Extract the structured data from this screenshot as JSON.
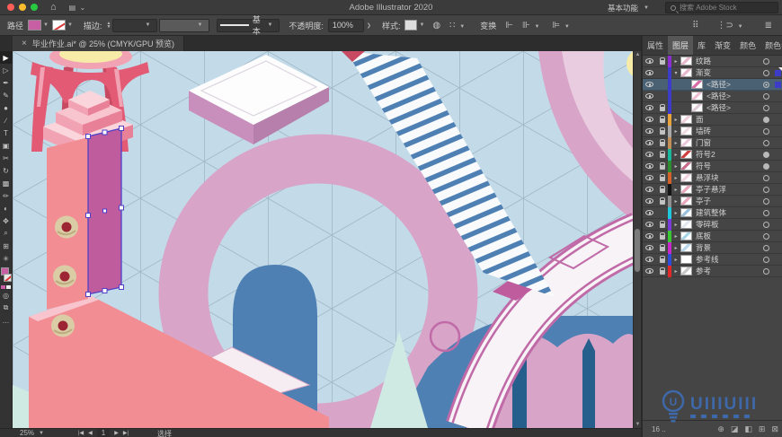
{
  "app": {
    "title": "Adobe Illustrator 2020",
    "workspace_switcher": "基本功能",
    "search_placeholder": "搜索 Adobe Stock",
    "traffic_lights": [
      "#ff5f57",
      "#febc2e",
      "#28c840"
    ]
  },
  "control_bar": {
    "selection_type": "路径",
    "fill_color": "#C85FA5",
    "stroke_label": "描边:",
    "brush_name": "基本",
    "opacity_label": "不透明度:",
    "opacity_value": "100%",
    "style_label": "样式:",
    "transform_label": "变换",
    "icons": [
      {
        "name": "recolor-artwork-icon",
        "glyph": "◍"
      },
      {
        "name": "align-pixel-grid-icon",
        "glyph": "∷"
      },
      {
        "name": "align-objects-icon",
        "glyph": "⊩"
      },
      {
        "name": "distribute-objects-icon",
        "glyph": "⊪"
      }
    ],
    "right_icons": [
      {
        "name": "document-setup-icon",
        "glyph": "⠿"
      },
      {
        "name": "shape-mode-icon",
        "glyph": "⋮⊃"
      },
      {
        "name": "panel-options-icon",
        "glyph": "≣"
      }
    ]
  },
  "document": {
    "tab_title": "毕业作业.ai* @ 25% (CMYK/GPU 预览)",
    "close_glyph": "×"
  },
  "toolbar": {
    "tools": [
      {
        "name": "selection-tool",
        "glyph": "▶",
        "active": true
      },
      {
        "name": "direct-selection-tool",
        "glyph": "▷",
        "active": false
      },
      {
        "name": "pen-tool",
        "glyph": "✒",
        "active": false
      },
      {
        "name": "curvature-tool",
        "glyph": "✎",
        "active": false
      },
      {
        "name": "ellipse-tool",
        "glyph": "●",
        "active": false
      },
      {
        "name": "line-segment-tool",
        "glyph": "∕",
        "active": false
      },
      {
        "name": "type-tool",
        "glyph": "T",
        "active": false
      },
      {
        "name": "rectangle-tool",
        "glyph": "▣",
        "active": false
      },
      {
        "name": "scissors-tool",
        "glyph": "✂",
        "active": false
      },
      {
        "name": "rotate-tool",
        "glyph": "↻",
        "active": false
      },
      {
        "name": "gradient-tool",
        "glyph": "▩",
        "active": false
      },
      {
        "name": "paintbrush-tool",
        "glyph": "✏",
        "active": false
      },
      {
        "name": "shape-builder-tool",
        "glyph": "◐",
        "active": false
      },
      {
        "name": "hand-tool",
        "glyph": "✥",
        "active": false
      },
      {
        "name": "zoom-tool",
        "glyph": "⌕",
        "active": false
      },
      {
        "name": "artboard-tool",
        "glyph": "⊞",
        "active": false
      },
      {
        "name": "symbol-sprayer-tool",
        "glyph": "✳",
        "active": false
      }
    ],
    "more_glyph": "…"
  },
  "canvas": {
    "selection_outline_color": "#5040C8",
    "watermark_text": "UIIIUIII",
    "watermark_color": "#3d6fba"
  },
  "status_bar": {
    "zoom_value": "25%",
    "first_glyph": "|◀",
    "prev_glyph": "◀",
    "artboard_number": "1",
    "next_glyph": "▶",
    "last_glyph": "▶|",
    "tool_status": "选择"
  },
  "layers_panel": {
    "tabs": [
      {
        "label": "属性",
        "active": false
      },
      {
        "label": "图层",
        "active": true
      },
      {
        "label": "库",
        "active": false
      },
      {
        "label": "渐变",
        "active": false
      },
      {
        "label": "颜色",
        "active": false
      },
      {
        "label": "颜色参",
        "active": false
      }
    ],
    "menu_glyph": "≡",
    "rows": [
      {
        "name": "纹路",
        "color": "#8b2fd0",
        "locked": true,
        "arrow": "▸",
        "thumb": "#e8b8cc",
        "target": "o",
        "sub": false,
        "selected": false,
        "sel_square": false,
        "corner": false
      },
      {
        "name": "渐变",
        "color": "#3c3cc8",
        "locked": false,
        "arrow": "▾",
        "thumb": "#e8b8cc",
        "target": "o",
        "sub": false,
        "selected": false,
        "sel_square": true,
        "corner": true
      },
      {
        "name": "<路径>",
        "color": "#3c3cc8",
        "locked": false,
        "arrow": "",
        "thumb": "#d86aa8",
        "target": "dot",
        "sub": true,
        "selected": true,
        "sel_square": true,
        "corner": false
      },
      {
        "name": "<路径>",
        "color": "#3c3cc8",
        "locked": false,
        "arrow": "",
        "thumb": "#f0c0d4",
        "target": "o",
        "sub": true,
        "selected": false,
        "sel_square": false,
        "corner": false
      },
      {
        "name": "<路径>",
        "color": "#3c3cc8",
        "locked": true,
        "arrow": "",
        "thumb": "#e0ccd8",
        "target": "o",
        "sub": true,
        "selected": false,
        "sel_square": false,
        "corner": false
      },
      {
        "name": "面",
        "color": "#e8a33c",
        "locked": true,
        "arrow": "▸",
        "thumb": "#f0d0dc",
        "target": "fill",
        "sub": false,
        "selected": false,
        "sel_square": false,
        "corner": false
      },
      {
        "name": "墙砖",
        "color": "#a9a9a9",
        "locked": true,
        "arrow": "▸",
        "thumb": "#f0dce4",
        "target": "o",
        "sub": false,
        "selected": false,
        "sel_square": false,
        "corner": false
      },
      {
        "name": "门窗",
        "color": "#c29057",
        "locked": true,
        "arrow": "▸",
        "thumb": "#eccadc",
        "target": "o",
        "sub": false,
        "selected": false,
        "sel_square": false,
        "corner": false
      },
      {
        "name": "符号2",
        "color": "#17b89b",
        "locked": true,
        "arrow": "▸",
        "thumb": "#d04040",
        "target": "fill",
        "sub": false,
        "selected": false,
        "sel_square": false,
        "corner": false
      },
      {
        "name": "符号",
        "color": "#2f8b2f",
        "locked": true,
        "arrow": "▸",
        "thumb": "#c86a8a",
        "target": "fill",
        "sub": false,
        "selected": false,
        "sel_square": false,
        "corner": false
      },
      {
        "name": "悬浮块",
        "color": "#d2622a",
        "locked": true,
        "arrow": "▸",
        "thumb": "#f0d4e0",
        "target": "o",
        "sub": false,
        "selected": false,
        "sel_square": false,
        "corner": false
      },
      {
        "name": "亭子悬浮",
        "color": "#151515",
        "locked": true,
        "arrow": "▸",
        "thumb": "#eaa8bc",
        "target": "o",
        "sub": false,
        "selected": false,
        "sel_square": false,
        "corner": false
      },
      {
        "name": "亭子",
        "color": "#8f8f8f",
        "locked": true,
        "arrow": "▸",
        "thumb": "#eaa8bc",
        "target": "o",
        "sub": false,
        "selected": false,
        "sel_square": false,
        "corner": false
      },
      {
        "name": "建筑整体",
        "color": "#20c8dc",
        "locked": false,
        "arrow": "▸",
        "thumb": "#9cc0dc",
        "target": "o",
        "sub": false,
        "selected": false,
        "sel_square": false,
        "corner": false
      },
      {
        "name": "零碎板",
        "color": "#7a3cd8",
        "locked": true,
        "arrow": "▸",
        "thumb": "#e4e8f0",
        "target": "o",
        "sub": false,
        "selected": false,
        "sel_square": false,
        "corner": false
      },
      {
        "name": "底板",
        "color": "#38c832",
        "locked": true,
        "arrow": "▸",
        "thumb": "#a8d4e8",
        "target": "o",
        "sub": false,
        "selected": false,
        "sel_square": false,
        "corner": false
      },
      {
        "name": "背景",
        "color": "#c828c8",
        "locked": true,
        "arrow": "▸",
        "thumb": "#b8d8ec",
        "target": "o",
        "sub": false,
        "selected": false,
        "sel_square": false,
        "corner": false
      },
      {
        "name": "参考线",
        "color": "#2e4cd8",
        "locked": true,
        "arrow": "▸",
        "thumb": "#ffffff",
        "target": "o",
        "sub": false,
        "selected": false,
        "sel_square": false,
        "corner": false
      },
      {
        "name": "参考",
        "color": "#e02828",
        "locked": true,
        "arrow": "▸",
        "thumb": "#c8c8c8",
        "target": "o",
        "sub": false,
        "selected": false,
        "sel_square": false,
        "corner": false
      }
    ],
    "footer": {
      "layer_count": "16 ..",
      "icons": [
        {
          "name": "locate-object-icon",
          "glyph": "⊕"
        },
        {
          "name": "clipping-mask-icon",
          "glyph": "◪"
        },
        {
          "name": "new-sublayer-icon",
          "glyph": "◧"
        },
        {
          "name": "new-layer-icon",
          "glyph": "⊞"
        },
        {
          "name": "delete-layer-icon",
          "glyph": "⊠"
        }
      ]
    }
  }
}
